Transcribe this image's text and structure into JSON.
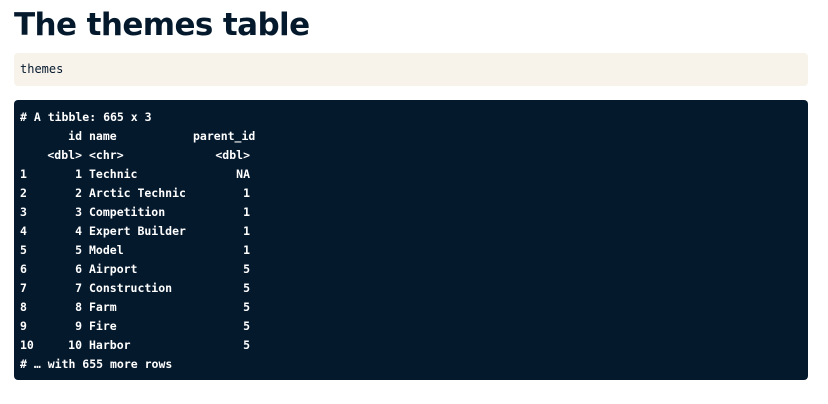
{
  "page": {
    "title": "The themes table"
  },
  "code_input": {
    "text": "themes"
  },
  "output": {
    "header": "# A tibble: 665 x 3",
    "columns": [
      "id",
      "name",
      "parent_id"
    ],
    "types": [
      "<dbl>",
      "<chr>",
      "<dbl>"
    ],
    "rows": [
      {
        "idx": "1",
        "id": "1",
        "name": "Technic",
        "parent_id": "NA"
      },
      {
        "idx": "2",
        "id": "2",
        "name": "Arctic Technic",
        "parent_id": "1"
      },
      {
        "idx": "3",
        "id": "3",
        "name": "Competition",
        "parent_id": "1"
      },
      {
        "idx": "4",
        "id": "4",
        "name": "Expert Builder",
        "parent_id": "1"
      },
      {
        "idx": "5",
        "id": "5",
        "name": "Model",
        "parent_id": "1"
      },
      {
        "idx": "6",
        "id": "6",
        "name": "Airport",
        "parent_id": "5"
      },
      {
        "idx": "7",
        "id": "7",
        "name": "Construction",
        "parent_id": "5"
      },
      {
        "idx": "8",
        "id": "8",
        "name": "Farm",
        "parent_id": "5"
      },
      {
        "idx": "9",
        "id": "9",
        "name": "Fire",
        "parent_id": "5"
      },
      {
        "idx": "10",
        "id": "10",
        "name": "Harbor",
        "parent_id": "5"
      }
    ],
    "footer": "# … with 655 more rows"
  },
  "colors": {
    "text_dark": "#05192d",
    "code_bg": "#f7f3eb",
    "console_bg": "#05192d",
    "console_text": "#ffffff"
  }
}
